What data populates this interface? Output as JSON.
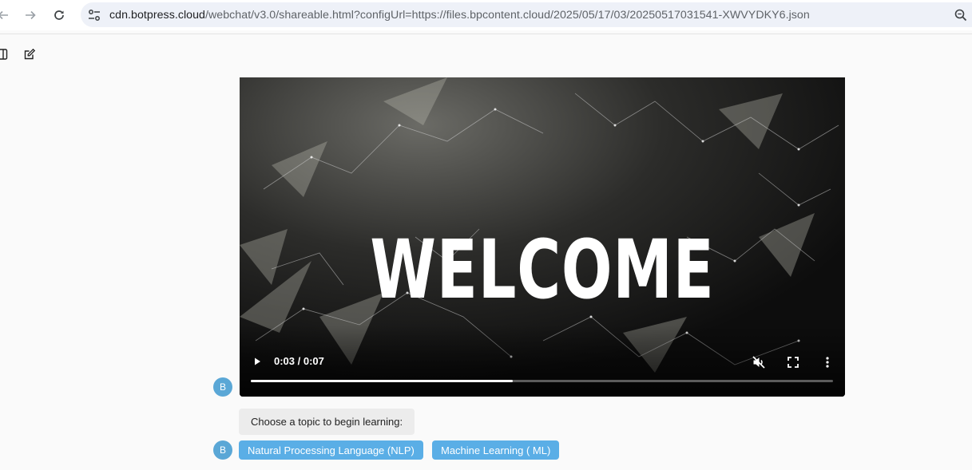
{
  "browser": {
    "url_domain": "cdn.botpress.cloud",
    "url_rest": "/webchat/v3.0/shareable.html?configUrl=https://files.bpcontent.cloud/2025/05/17/03/20250517031541-XWVYDKY6.json",
    "icons": [
      "back-arrow-icon",
      "forward-arrow-icon",
      "reload-icon",
      "site-settings-icon",
      "zoom-icon"
    ]
  },
  "page_toolbar": {
    "icons": [
      "sidebar-toggle-icon",
      "new-conversation-icon"
    ]
  },
  "video": {
    "overlay_text": "WELCOME",
    "time_display": "0:03 / 0:07",
    "progress": 0.45,
    "controls": [
      "play-icon",
      "muted-icon",
      "fullscreen-icon",
      "more-options-icon"
    ]
  },
  "chat": {
    "avatar_letter": "B",
    "prompt": "Choose a topic to begin learning:",
    "choices": [
      "Natural Processing Language (NLP)",
      "Machine Learning ( ML)"
    ]
  },
  "colors": {
    "accent": "#5aaee6",
    "avatar": "#5aa7d6",
    "bubble": "#ececec"
  }
}
